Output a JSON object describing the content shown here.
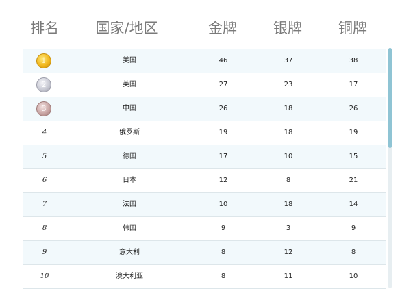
{
  "header": {
    "rank": "排名",
    "country": "国家/地区",
    "gold": "金牌",
    "silver": "银牌",
    "bronze": "铜牌"
  },
  "rows": [
    {
      "rank": "1",
      "medal": "gold",
      "country": "美国",
      "gold": "46",
      "silver": "37",
      "bronze": "38"
    },
    {
      "rank": "2",
      "medal": "silver",
      "country": "英国",
      "gold": "27",
      "silver": "23",
      "bronze": "17"
    },
    {
      "rank": "3",
      "medal": "bronze",
      "country": "中国",
      "gold": "26",
      "silver": "18",
      "bronze": "26"
    },
    {
      "rank": "4",
      "country": "俄罗斯",
      "gold": "19",
      "silver": "18",
      "bronze": "19"
    },
    {
      "rank": "5",
      "country": "德国",
      "gold": "17",
      "silver": "10",
      "bronze": "15"
    },
    {
      "rank": "6",
      "country": "日本",
      "gold": "12",
      "silver": "8",
      "bronze": "21"
    },
    {
      "rank": "7",
      "country": "法国",
      "gold": "10",
      "silver": "18",
      "bronze": "14"
    },
    {
      "rank": "8",
      "country": "韩国",
      "gold": "9",
      "silver": "3",
      "bronze": "9"
    },
    {
      "rank": "9",
      "country": "意大利",
      "gold": "8",
      "silver": "12",
      "bronze": "8"
    },
    {
      "rank": "10",
      "country": "澳大利亚",
      "gold": "8",
      "silver": "11",
      "bronze": "10"
    }
  ],
  "colors": {
    "header_text": "#7a7a7a",
    "row_alt": "#f2f9fc",
    "scroll_thumb": "#8fc4d4"
  },
  "icons": {
    "gold": "gold-medal-icon",
    "silver": "silver-medal-icon",
    "bronze": "bronze-medal-icon"
  }
}
